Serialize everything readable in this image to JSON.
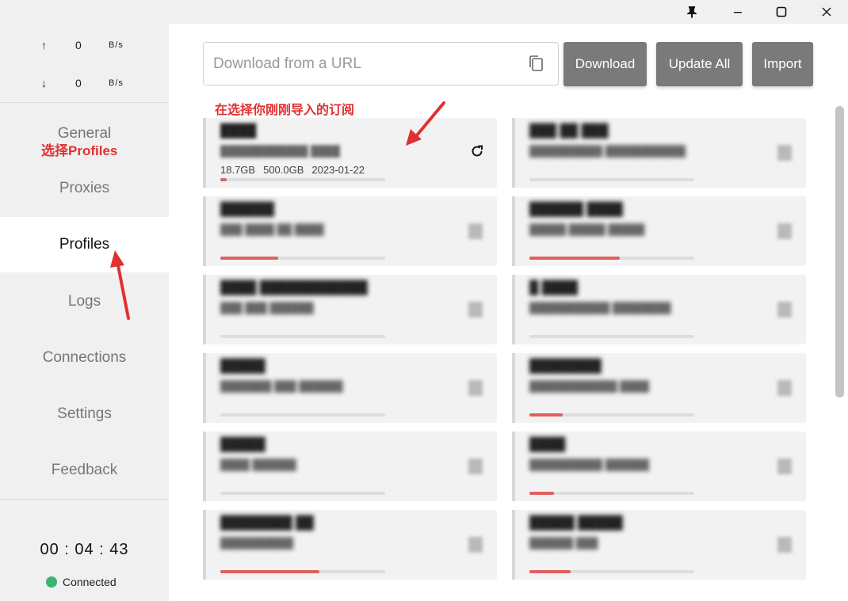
{
  "window": {
    "controls": [
      "pin-icon",
      "minimize-icon",
      "maximize-icon",
      "close-icon"
    ]
  },
  "traffic": {
    "up_arrow": "↑",
    "up_value": "0",
    "up_unit": "B/s",
    "down_arrow": "↓",
    "down_value": "0",
    "down_unit": "B/s"
  },
  "nav": {
    "general": "General",
    "proxies": "Proxies",
    "profiles": "Profiles",
    "logs": "Logs",
    "connections": "Connections",
    "settings": "Settings",
    "feedback": "Feedback",
    "active": "Profiles"
  },
  "annotations": {
    "select_profiles": "选择Profiles",
    "select_subscription": "在选择你刚刚导入的订阅",
    "color": "#e03131"
  },
  "status": {
    "timer": "00 : 04 : 43",
    "connection": "Connected",
    "connection_color": "#3cb371"
  },
  "toolbar": {
    "url_placeholder": "Download from a URL",
    "download_label": "Download",
    "update_all_label": "Update All",
    "import_label": "Import",
    "button_color": "#7a7a7a"
  },
  "profiles": [
    {
      "name": "████",
      "url": "████████████ ████",
      "used": "18.7GB",
      "total": "500.0GB",
      "expire": "2023-01-22",
      "usage_fraction": 0.04
    },
    {
      "name": "███ ██ ███",
      "url": "██████████ ███████████",
      "used": "",
      "total": "",
      "expire": "",
      "usage_fraction": 0
    },
    {
      "name": "██████",
      "url": "███ ████ ██ ████",
      "used": "",
      "total": "",
      "expire": "",
      "usage_fraction": 0.35
    },
    {
      "name": "██████ ████",
      "url": "█████ █████ █████",
      "used": "",
      "total": "",
      "expire": "",
      "usage_fraction": 0.55
    },
    {
      "name": "████ ████████████",
      "url": "███ ███  ██████",
      "used": "",
      "total": "",
      "expire": "",
      "usage_fraction": 0
    },
    {
      "name": "█ ████",
      "url": "███████████ ████████",
      "used": "",
      "total": "",
      "expire": "",
      "usage_fraction": 0
    },
    {
      "name": "█████",
      "url": "███████ ███ ██████",
      "used": "",
      "total": "",
      "expire": "",
      "usage_fraction": 0
    },
    {
      "name": "████████",
      "url": "████████████ ████",
      "used": "",
      "total": "",
      "expire": "",
      "usage_fraction": 0.2
    },
    {
      "name": "█████",
      "url": "████ ██████",
      "used": "",
      "total": "",
      "expire": "",
      "usage_fraction": 0
    },
    {
      "name": "████",
      "url": "██████████ ██████",
      "used": "",
      "total": "",
      "expire": "",
      "usage_fraction": 0.15
    },
    {
      "name": "████████ ██",
      "url": "██████████",
      "used": "",
      "total": "",
      "expire": "",
      "usage_fraction": 0.6
    },
    {
      "name": "█████ █████",
      "url": "██████ ███",
      "used": "",
      "total": "",
      "expire": "",
      "usage_fraction": 0.25
    }
  ]
}
